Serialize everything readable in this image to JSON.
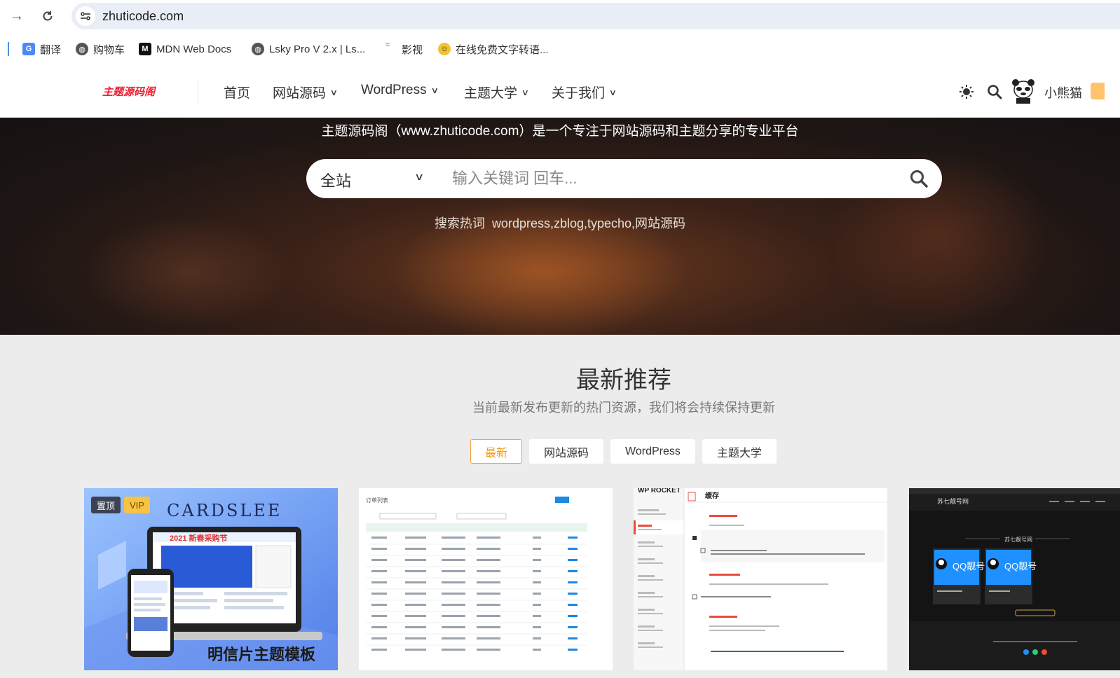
{
  "browser": {
    "url": "zhuticode.com",
    "bookmarks": [
      {
        "label": "翻译",
        "icon": "google-translate-icon"
      },
      {
        "label": "购物车",
        "icon": "globe-icon"
      },
      {
        "label": "MDN Web Docs",
        "icon": "mdn-icon"
      },
      {
        "label": "Lsky Pro V 2.x | Ls...",
        "icon": "globe-icon"
      },
      {
        "label": "影视",
        "icon": "swirl-icon"
      },
      {
        "label": "在线免费文字转语...",
        "icon": "smile-icon"
      }
    ]
  },
  "header": {
    "logo_text": "主题源码阁",
    "nav": [
      {
        "label": "首页",
        "dropdown": false
      },
      {
        "label": "网站源码",
        "dropdown": true
      },
      {
        "label": "WordPress",
        "dropdown": true
      },
      {
        "label": "主题大学",
        "dropdown": true
      },
      {
        "label": "关于我们",
        "dropdown": true
      }
    ],
    "username": "小熊猫"
  },
  "hero": {
    "tagline": "主题源码阁（www.zhuticode.com）是一个专注于网站源码和主题分享的专业平台",
    "search_category": "全站",
    "search_placeholder": "输入关键词 回车...",
    "hot_label": "搜索热词",
    "hot_words": "wordpress,zblog,typecho,网站源码"
  },
  "section": {
    "title": "最新推荐",
    "subtitle": "当前最新发布更新的热门资源，我们将会持续保持更新",
    "tabs": [
      "最新",
      "网站源码",
      "WordPress",
      "主题大学"
    ],
    "active_tab": "最新"
  },
  "cards": [
    {
      "badges": [
        "置顶",
        "VIP"
      ],
      "thumb_title": "CARDSLEE",
      "thumb_caption": "明信片主题模板",
      "promo": "2021 新春采购节"
    },
    {
      "thumb_title": "订单列表"
    },
    {
      "thumb_brand": "WP ROCKET",
      "thumb_title": "缓存"
    },
    {
      "thumb_title": "苏七靓号网",
      "thumb_tile": "QQ靓号"
    }
  ],
  "colors": {
    "accent": "#f39c12",
    "hero_dark": "#1e1614",
    "page_bg": "#ececec"
  }
}
